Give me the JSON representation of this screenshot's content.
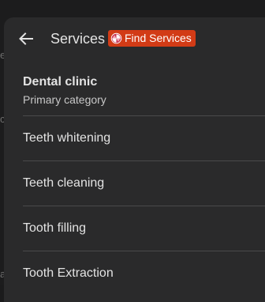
{
  "header": {
    "back_icon": "arrow-left-icon",
    "title": "Services",
    "badge": {
      "icon": "pinwheel-icon",
      "label": "Find Services",
      "color": "#d23b16"
    }
  },
  "category": {
    "name": "Dental clinic",
    "subtitle": "Primary category"
  },
  "services": [
    {
      "label": "Teeth whitening"
    },
    {
      "label": "Teeth cleaning"
    },
    {
      "label": "Tooth filling"
    },
    {
      "label": "Tooth Extraction"
    }
  ],
  "colors": {
    "panel_bg": "#2a2a2b",
    "text": "#e3e3e3",
    "divider": "#4a4a4b"
  }
}
